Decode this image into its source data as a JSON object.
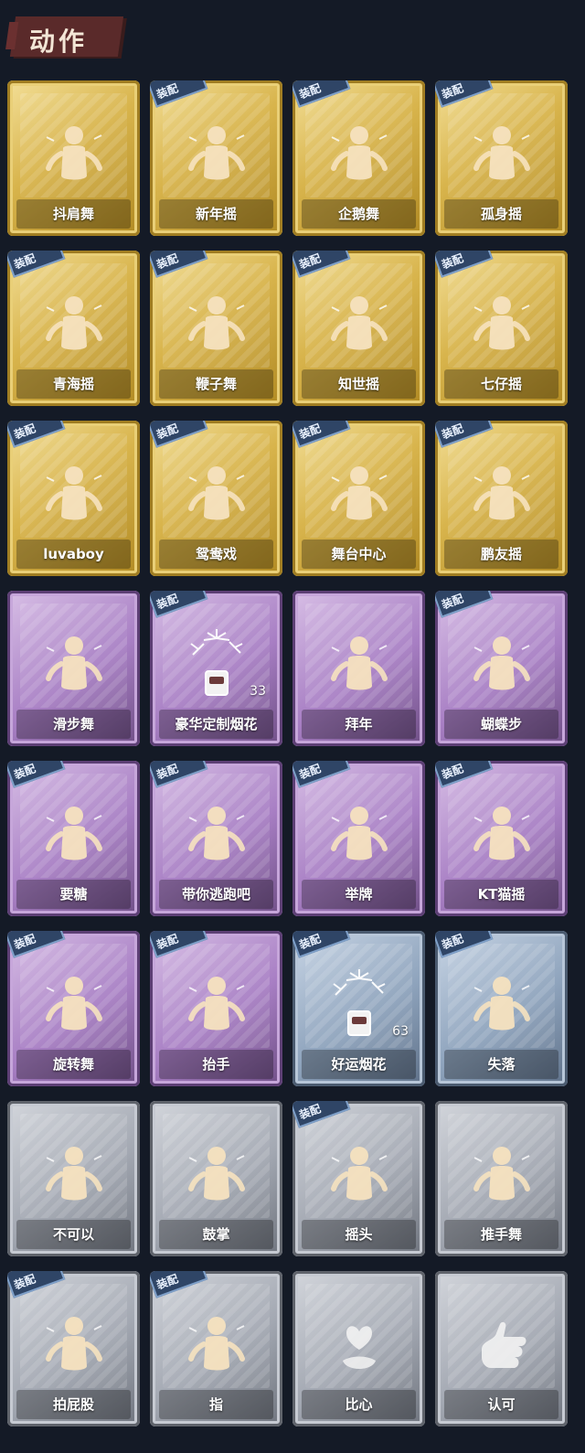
{
  "title": "动作",
  "equip_label": "装配",
  "colors": {
    "background": "#141a26",
    "gold": "#d8b44c",
    "purple": "#a87fc4",
    "blue": "#8fa4bd",
    "gray": "#a3a8b2",
    "equip_badge": "#2f4566"
  },
  "cards": [
    {
      "label": "抖肩舞",
      "rarity": "gold",
      "equipped": false,
      "icon": "dance-figure-icon"
    },
    {
      "label": "新年摇",
      "rarity": "gold",
      "equipped": true,
      "icon": "dance-figure-icon"
    },
    {
      "label": "企鹅舞",
      "rarity": "gold",
      "equipped": true,
      "icon": "dance-figure-icon"
    },
    {
      "label": "孤身摇",
      "rarity": "gold",
      "equipped": true,
      "icon": "dance-figure-icon"
    },
    {
      "label": "青海摇",
      "rarity": "gold",
      "equipped": true,
      "icon": "dance-figure-icon"
    },
    {
      "label": "鞭子舞",
      "rarity": "gold",
      "equipped": true,
      "icon": "dance-figure-icon"
    },
    {
      "label": "知世摇",
      "rarity": "gold",
      "equipped": true,
      "icon": "dance-figure-icon"
    },
    {
      "label": "七仔摇",
      "rarity": "gold",
      "equipped": true,
      "icon": "dance-figure-icon"
    },
    {
      "label": "luvaboy",
      "rarity": "gold",
      "equipped": true,
      "icon": "dance-figure-icon"
    },
    {
      "label": "鸳鸯戏",
      "rarity": "gold",
      "equipped": true,
      "icon": "dance-figure-icon"
    },
    {
      "label": "舞台中心",
      "rarity": "gold",
      "equipped": true,
      "icon": "dance-figure-icon"
    },
    {
      "label": "鹏友摇",
      "rarity": "gold",
      "equipped": true,
      "icon": "dance-figure-icon"
    },
    {
      "label": "滑步舞",
      "rarity": "purple",
      "equipped": false,
      "icon": "dance-figure-icon"
    },
    {
      "label": "豪华定制烟花",
      "rarity": "purple",
      "equipped": true,
      "icon": "fireworks-icon",
      "count": "33"
    },
    {
      "label": "拜年",
      "rarity": "purple",
      "equipped": false,
      "icon": "bow-figure-icon"
    },
    {
      "label": "蝴蝶步",
      "rarity": "purple",
      "equipped": true,
      "icon": "dance-figure-icon"
    },
    {
      "label": "要糖",
      "rarity": "purple",
      "equipped": true,
      "icon": "reach-figure-icon"
    },
    {
      "label": "带你逃跑吧",
      "rarity": "purple",
      "equipped": true,
      "icon": "run-figure-icon"
    },
    {
      "label": "举牌",
      "rarity": "purple",
      "equipped": true,
      "icon": "sign-figure-icon"
    },
    {
      "label": "KT猫摇",
      "rarity": "purple",
      "equipped": true,
      "icon": "dance-figure-icon"
    },
    {
      "label": "旋转舞",
      "rarity": "purple",
      "equipped": true,
      "icon": "spin-figure-icon"
    },
    {
      "label": "抬手",
      "rarity": "purple",
      "equipped": true,
      "icon": "raise-hand-icon"
    },
    {
      "label": "好运烟花",
      "rarity": "blue",
      "equipped": true,
      "icon": "fireworks-icon",
      "count": "63"
    },
    {
      "label": "失落",
      "rarity": "blue",
      "equipped": true,
      "icon": "crawl-figure-icon"
    },
    {
      "label": "不可以",
      "rarity": "gray",
      "equipped": false,
      "icon": "finger-wave-icon"
    },
    {
      "label": "鼓掌",
      "rarity": "gray",
      "equipped": false,
      "icon": "clap-icon"
    },
    {
      "label": "摇头",
      "rarity": "gray",
      "equipped": true,
      "icon": "shake-head-icon"
    },
    {
      "label": "推手舞",
      "rarity": "gray",
      "equipped": false,
      "icon": "push-hands-icon"
    },
    {
      "label": "拍屁股",
      "rarity": "gray",
      "equipped": true,
      "icon": "slap-figure-icon"
    },
    {
      "label": "指",
      "rarity": "gray",
      "equipped": true,
      "icon": "point-hand-icon"
    },
    {
      "label": "比心",
      "rarity": "gray",
      "equipped": false,
      "icon": "heart-hand-icon"
    },
    {
      "label": "认可",
      "rarity": "gray",
      "equipped": false,
      "icon": "thumbs-up-icon"
    }
  ]
}
